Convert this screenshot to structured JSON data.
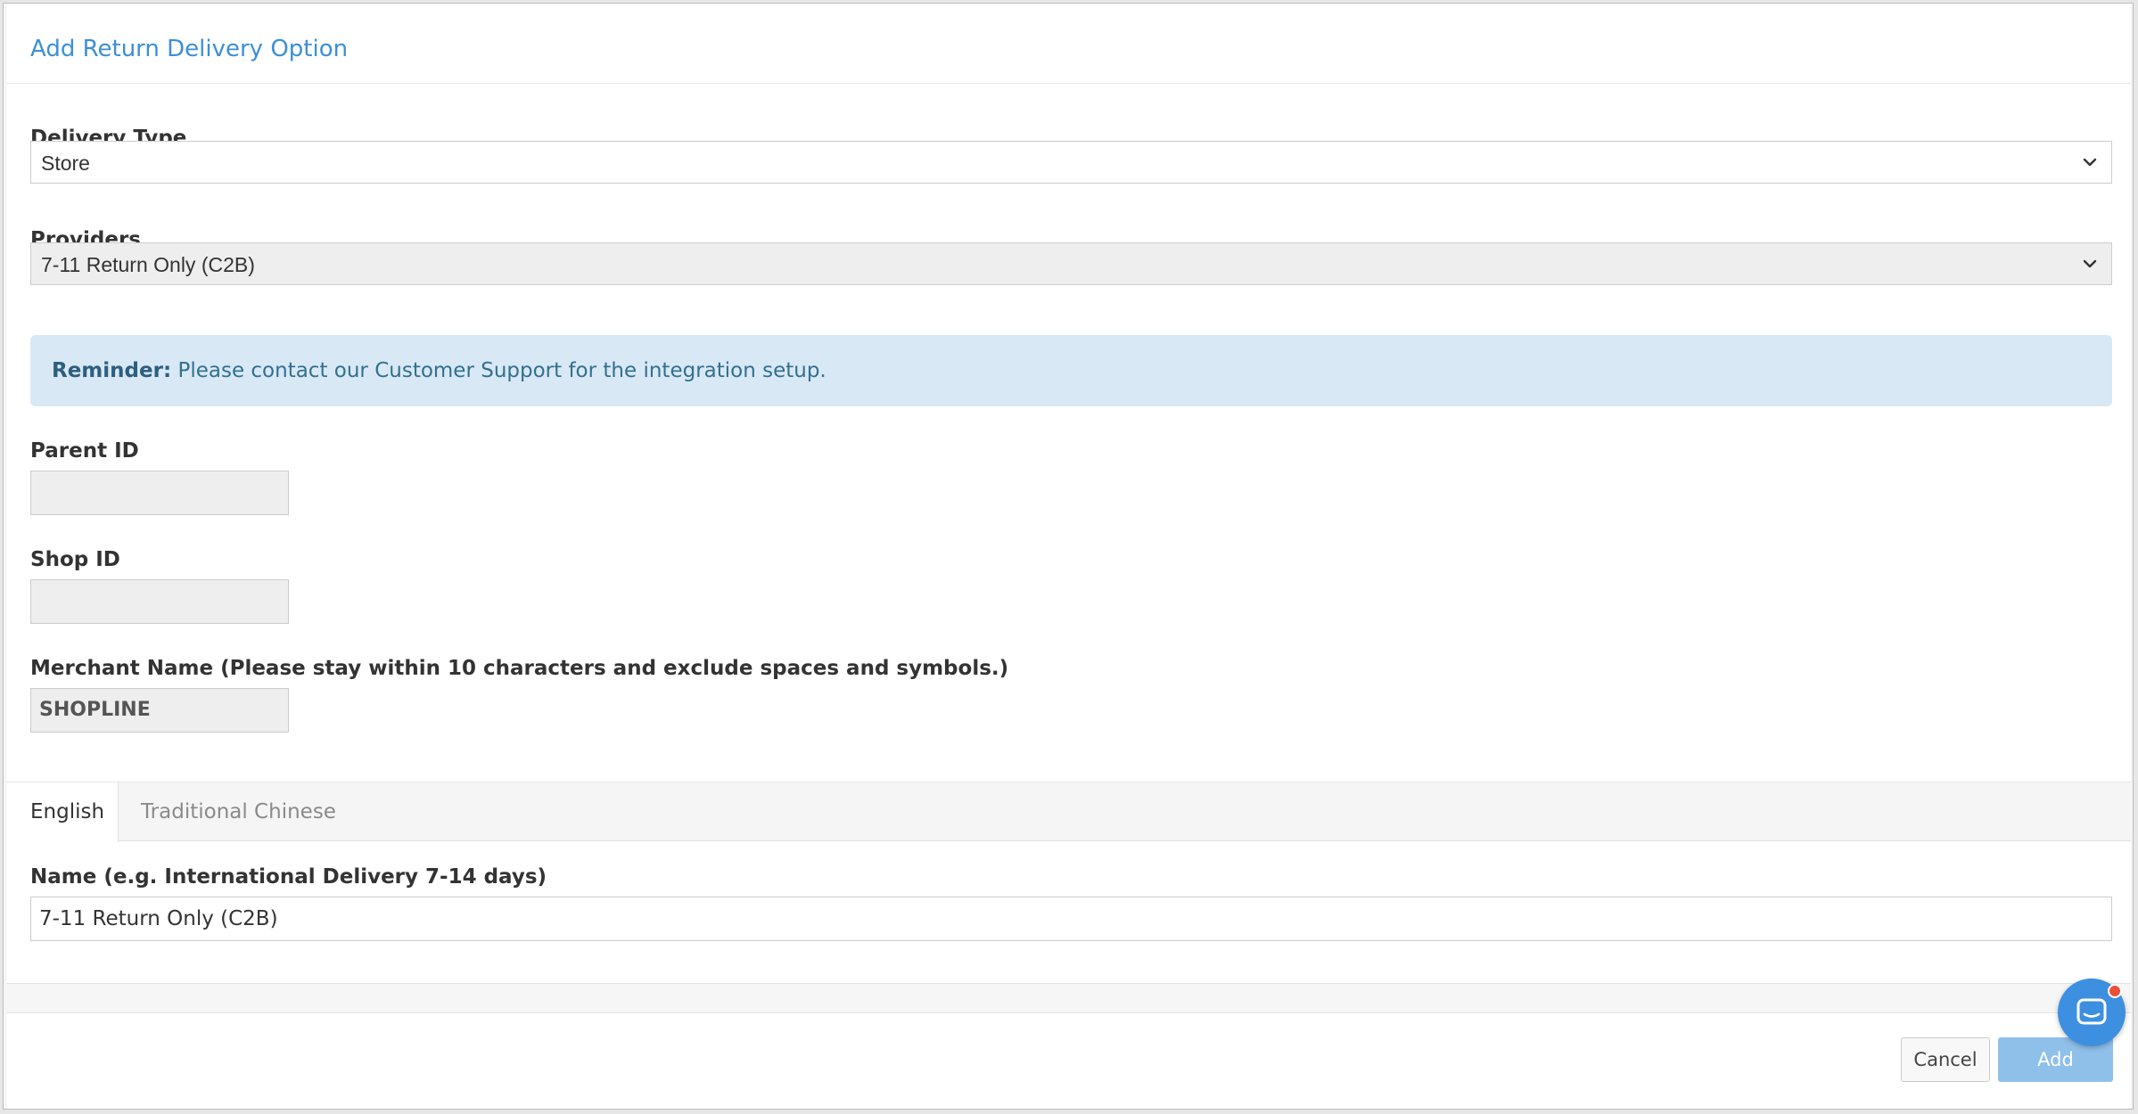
{
  "modal": {
    "title": "Add Return Delivery Option"
  },
  "delivery_type": {
    "label": "Delivery Type",
    "value": "Store"
  },
  "providers": {
    "label": "Providers",
    "value": "7-11 Return Only (C2B)"
  },
  "reminder": {
    "prefix": "Reminder:",
    "text": " Please contact our Customer Support for the integration setup."
  },
  "parent_id": {
    "label": "Parent ID",
    "value": ""
  },
  "shop_id": {
    "label": "Shop ID",
    "value": ""
  },
  "merchant_name": {
    "label": "Merchant Name (Please stay within 10 characters and exclude spaces and symbols.)",
    "value": "SHOPLINE"
  },
  "tabs": [
    {
      "label": "English",
      "active": true
    },
    {
      "label": "Traditional Chinese",
      "active": false
    }
  ],
  "name_field": {
    "label": "Name (e.g. International Delivery 7-14 days)",
    "value": "7-11 Return Only (C2B)"
  },
  "footer": {
    "cancel_label": "Cancel",
    "add_label": "Add"
  },
  "icons": {
    "dropdown": "chevron-down-icon",
    "chat": "chat-icon"
  },
  "colors": {
    "accent": "#3d8fd6",
    "alert_bg": "#d9e8f5",
    "add_button": "#8fc0ea",
    "chat_button": "#3d8fe0",
    "notification_dot": "#e8503a"
  }
}
